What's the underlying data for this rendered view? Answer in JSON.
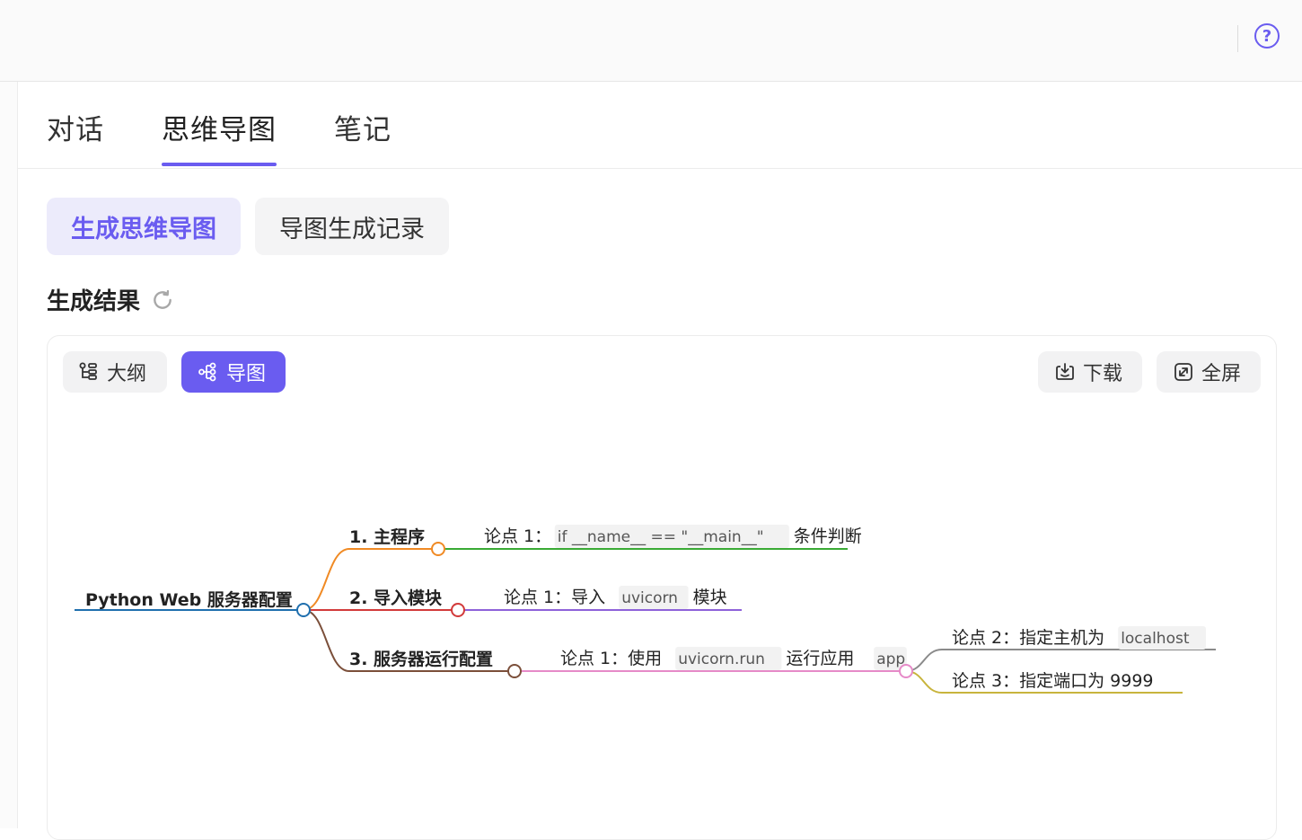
{
  "tabs": {
    "items": [
      "对话",
      "思维导图",
      "笔记"
    ],
    "active_index": 1
  },
  "subtabs": {
    "generate_label": "生成思维导图",
    "history_label": "导图生成记录"
  },
  "result": {
    "title": "生成结果"
  },
  "toolbar": {
    "outline_label": "大纲",
    "map_label": "导图",
    "download_label": "下载",
    "fullscreen_label": "全屏"
  },
  "colors": {
    "accent": "#6a5cf0",
    "root_line": "#1f6fae",
    "b1": "#f08a24",
    "b2": "#d23a3a",
    "b3": "#7b4f3a",
    "leaf1": "#3aaa35",
    "leaf2": "#8e62d9",
    "leaf3": "#e68ac8",
    "leaf3a": "#8a8a8a",
    "leaf3b": "#c8b43c"
  },
  "mindmap": {
    "root": "Python Web 服务器配置",
    "branches": [
      {
        "label": "1. 主程序",
        "leaf": [
          {
            "t": "论点 1："
          },
          {
            "t": "if __name__ == \"__main__\"",
            "code": true
          },
          {
            "t": " 条件判断"
          }
        ]
      },
      {
        "label": "2. 导入模块",
        "leaf": [
          {
            "t": "论点 1：导入 "
          },
          {
            "t": "uvicorn",
            "code": true
          },
          {
            "t": " 模块"
          }
        ]
      },
      {
        "label": "3. 服务器运行配置",
        "leaf": [
          {
            "t": "论点 1：使用 "
          },
          {
            "t": "uvicorn.run",
            "code": true
          },
          {
            "t": " 运行应用 "
          },
          {
            "t": "app",
            "code": true
          }
        ],
        "children": [
          [
            {
              "t": "论点 2：指定主机为 "
            },
            {
              "t": "localhost",
              "code": true
            }
          ],
          [
            {
              "t": "论点 3：指定端口为 9999"
            }
          ]
        ]
      }
    ]
  }
}
